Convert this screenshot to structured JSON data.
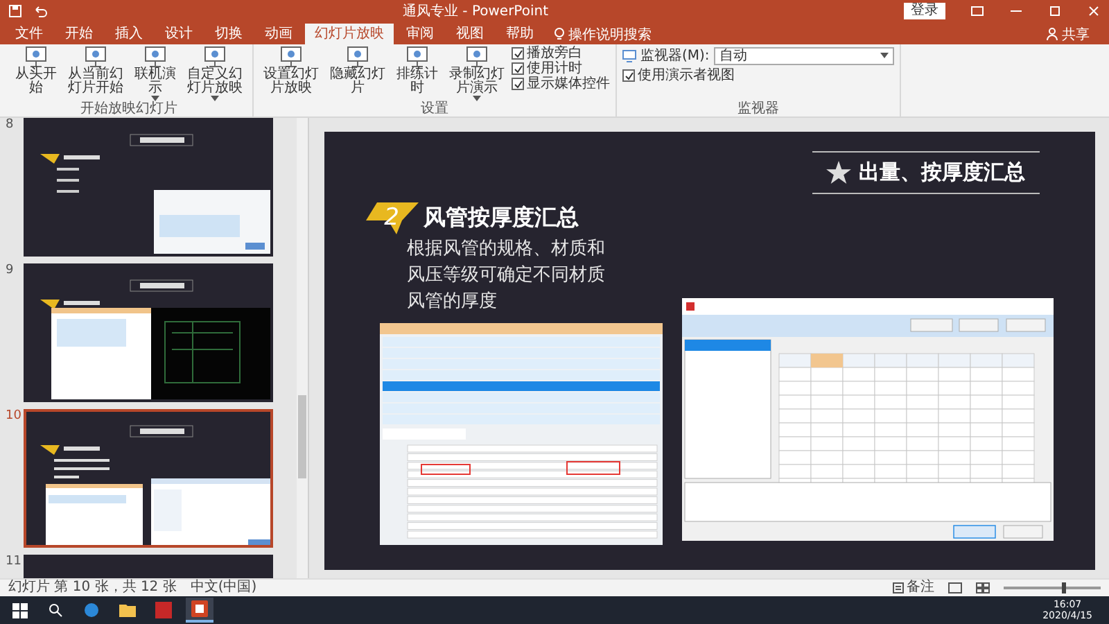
{
  "window": {
    "title": "通风专业 - PowerPoint",
    "sign_in": "登录",
    "share": "共享"
  },
  "ribbon_tabs": [
    {
      "label": "文件",
      "selected": false
    },
    {
      "label": "开始",
      "selected": false
    },
    {
      "label": "插入",
      "selected": false
    },
    {
      "label": "设计",
      "selected": false
    },
    {
      "label": "切换",
      "selected": false
    },
    {
      "label": "动画",
      "selected": false
    },
    {
      "label": "幻灯片放映",
      "selected": true
    },
    {
      "label": "审阅",
      "selected": false
    },
    {
      "label": "视图",
      "selected": false
    },
    {
      "label": "帮助",
      "selected": false
    }
  ],
  "tell_me": "操作说明搜索",
  "ribbon_groups": [
    {
      "label": "开始放映幻灯片",
      "items": [
        {
          "kind": "large",
          "label": "从头开始",
          "has_menu": false
        },
        {
          "kind": "large",
          "label": "从当前幻灯片开始",
          "has_menu": false
        },
        {
          "kind": "large",
          "label": "联机演示",
          "has_menu": true
        },
        {
          "kind": "large",
          "label": "自定义幻灯片放映",
          "has_menu": true
        }
      ]
    },
    {
      "label": "设置",
      "items": [
        {
          "kind": "large",
          "label": "设置幻灯片放映",
          "has_menu": false
        },
        {
          "kind": "large",
          "label": "隐藏幻灯片",
          "has_menu": false
        },
        {
          "kind": "large",
          "label": "排练计时",
          "has_menu": false
        },
        {
          "kind": "large",
          "label": "录制幻灯片演示",
          "has_menu": true
        },
        {
          "kind": "checks",
          "options": [
            {
              "label": "播放旁白",
              "checked": true
            },
            {
              "label": "使用计时",
              "checked": true
            },
            {
              "label": "显示媒体控件",
              "checked": true
            }
          ]
        }
      ]
    },
    {
      "label": "监视器",
      "items": [
        {
          "kind": "monitor",
          "label": "监视器(M):",
          "value": "自动"
        },
        {
          "kind": "checks",
          "options": [
            {
              "label": "使用演示者视图",
              "checked": true
            }
          ]
        }
      ]
    }
  ],
  "slide_panel": {
    "slides": [
      {
        "number": "8",
        "selected": false,
        "kind": "dialog"
      },
      {
        "number": "9",
        "selected": false,
        "kind": "cad"
      },
      {
        "number": "10",
        "selected": true,
        "kind": "tables"
      },
      {
        "number": "11",
        "selected": false,
        "kind": "blank"
      }
    ]
  },
  "slide": {
    "section_title": "出量、按厚度汇总",
    "badge": "2",
    "heading": "风管按厚度汇总",
    "body_lines": [
      "根据风管的规格、材质和",
      "风压等级可确定不同材质",
      "风管的厚度"
    ]
  },
  "status_bar": {
    "slide_info": "幻灯片 第 10 张，共 12 张",
    "language": "中文(中国)",
    "notes": "备注",
    "zoom": {
      "level": 0.6
    }
  },
  "taskbar": {
    "time": "16:07",
    "date": "2020/4/15"
  }
}
